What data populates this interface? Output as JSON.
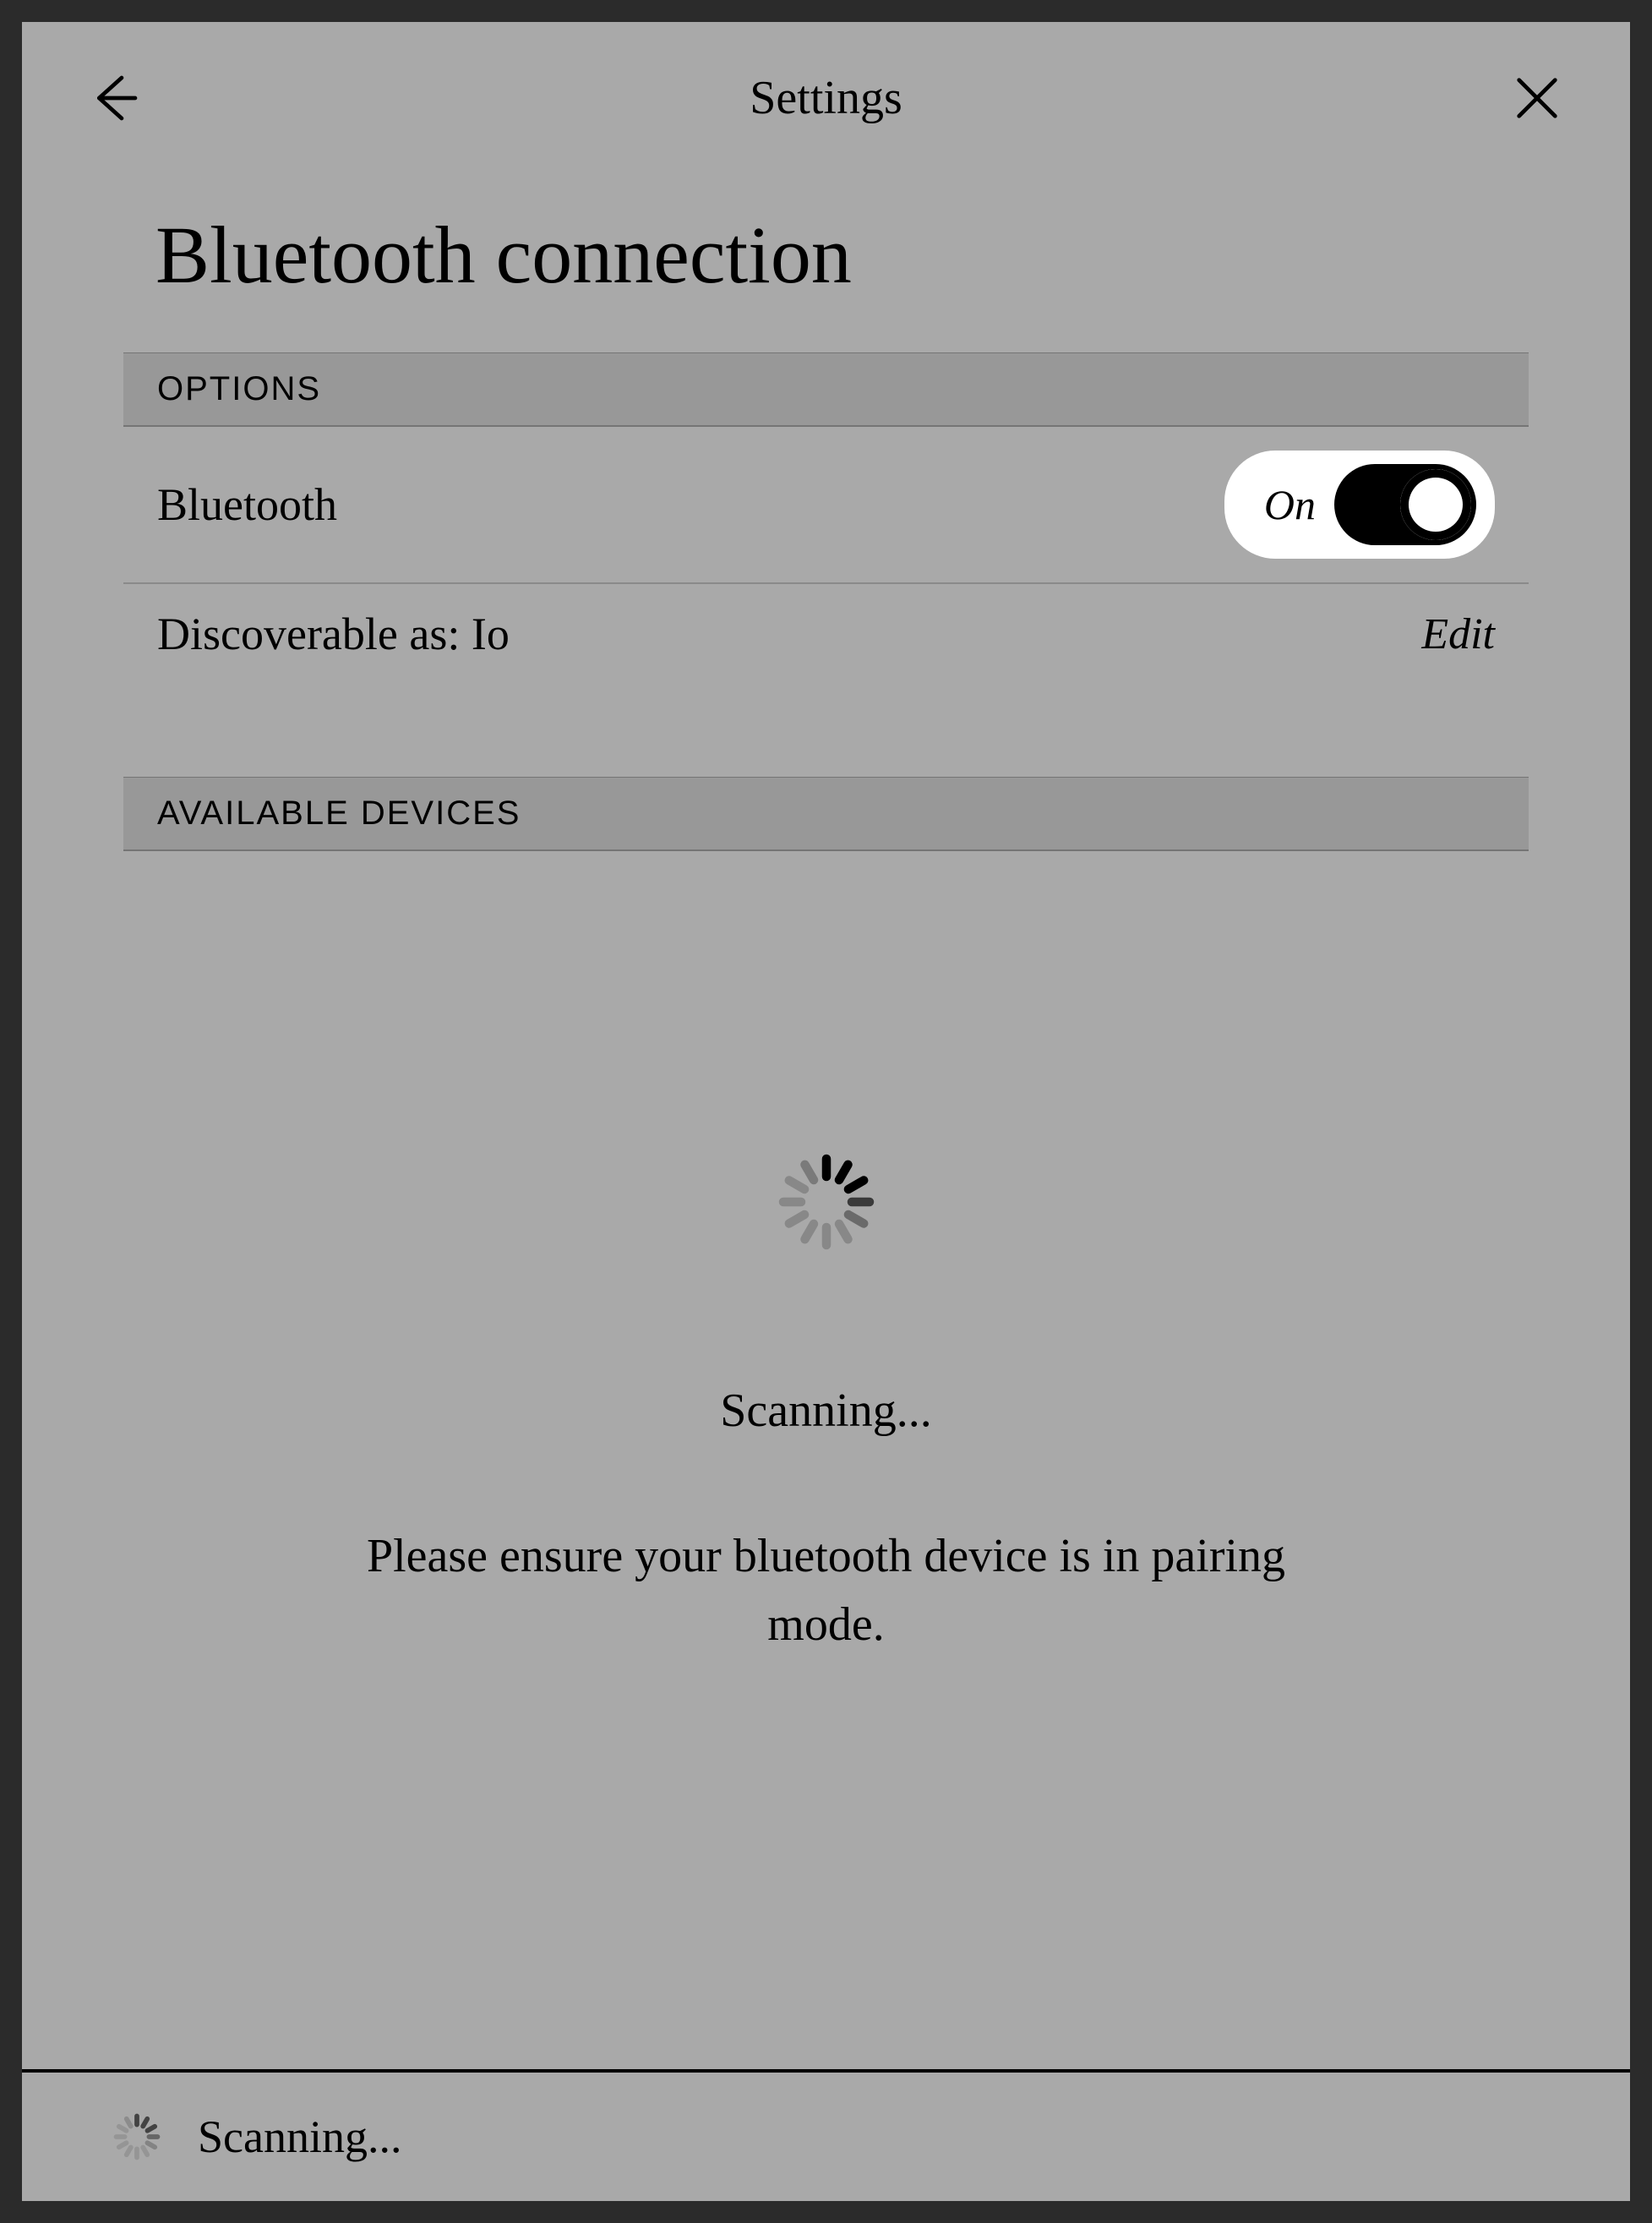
{
  "header": {
    "title": "Settings"
  },
  "page": {
    "title": "Bluetooth connection"
  },
  "options": {
    "header": "OPTIONS",
    "bluetooth": {
      "label": "Bluetooth",
      "state_text": "On"
    },
    "discoverable": {
      "label": "Discoverable as: Io",
      "edit_label": "Edit"
    }
  },
  "devices": {
    "header": "AVAILABLE DEVICES",
    "scan": {
      "status": "Scanning...",
      "hint": "Please ensure your bluetooth device is in pairing mode."
    }
  },
  "footer": {
    "status": "Scanning..."
  }
}
